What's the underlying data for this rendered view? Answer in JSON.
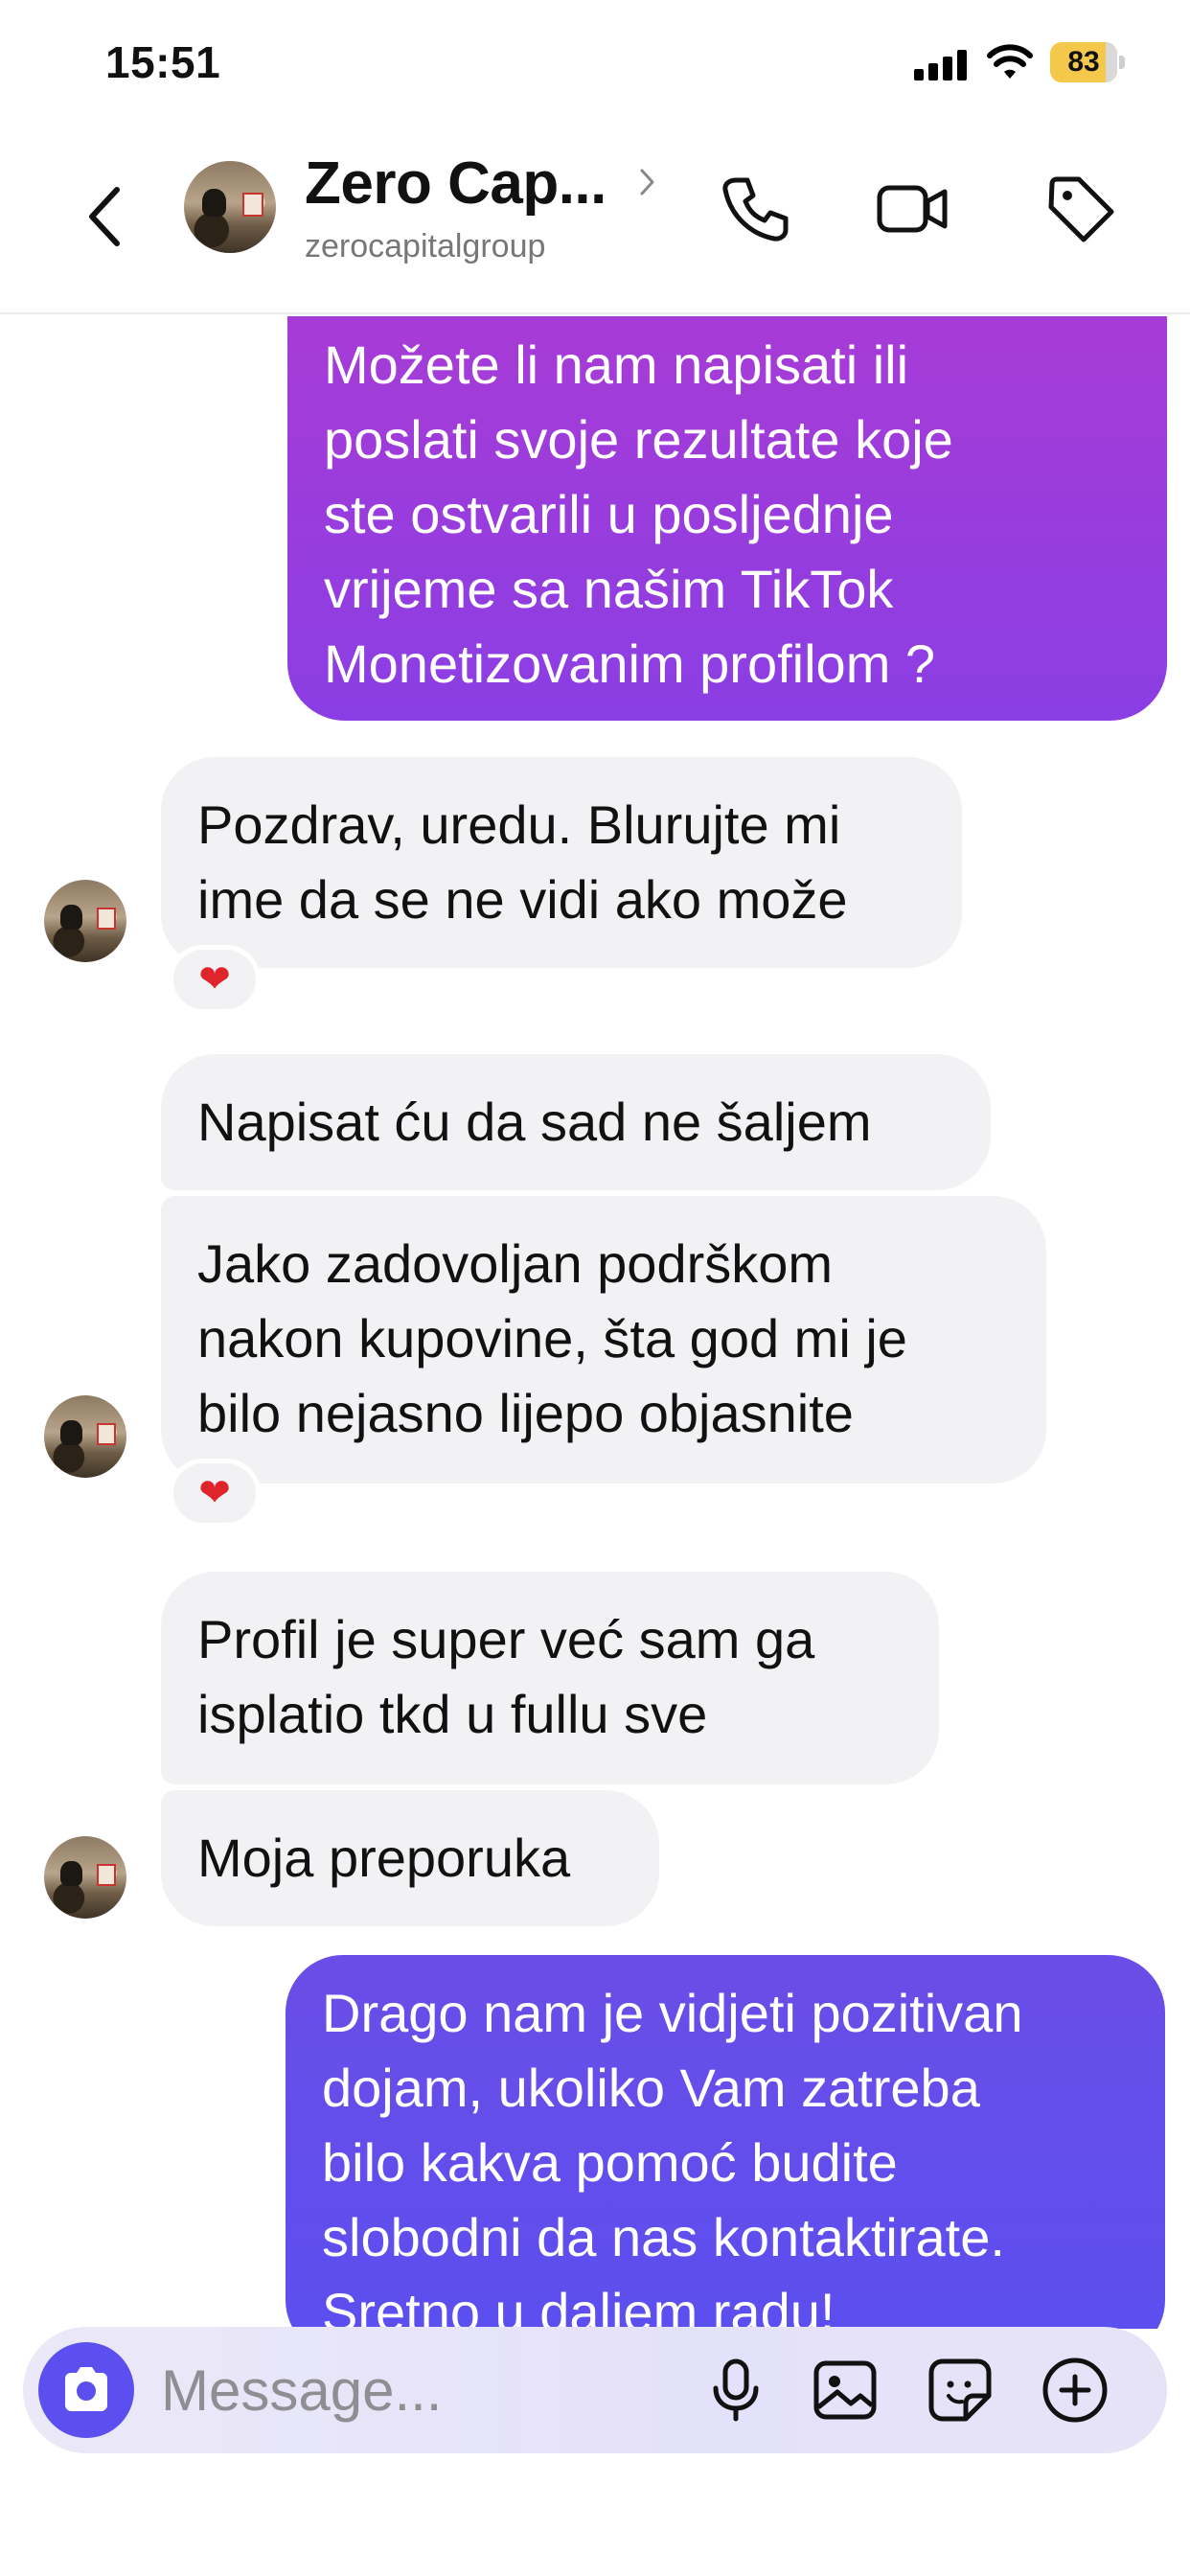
{
  "status_bar": {
    "time": "15:51",
    "battery": "83"
  },
  "header": {
    "contact_name": "Zero Cap...",
    "contact_handle": "zerocapitalgroup"
  },
  "messages": [
    {
      "direction": "out",
      "text": "Možete li nam napisati ili\nposlati svoje rezultate koje\nste ostvarili u posljednje\nvrijeme sa našim TikTok\nMonetizovanim profilom ?"
    },
    {
      "direction": "in",
      "text": "Pozdrav, uredu. Blurujte mi\nime da se ne vidi ako može",
      "reaction": "heart"
    },
    {
      "direction": "in",
      "text": "Napisat ću da sad ne šaljem"
    },
    {
      "direction": "in",
      "text": "Jako zadovoljan podrškom\nnakon kupovine, šta god mi je\nbilo nejasno lijepo objasnite",
      "reaction": "heart"
    },
    {
      "direction": "in",
      "text": "Profil je super već sam ga\nisplatio tkd u fullu sve"
    },
    {
      "direction": "in",
      "text": "Moja preporuka"
    },
    {
      "direction": "out",
      "text": "Drago nam je vidjeti pozitivan\ndojam, ukoliko Vam zatreba\nbilo kakva pomoć budite\nslobodni da nas kontaktirate.\nSretno u daljem radu!"
    }
  ],
  "reactions": {
    "heart": "❤"
  },
  "composer": {
    "placeholder": "Message..."
  },
  "colors": {
    "accent": "#5b4ff0",
    "outgoing_top": "#a83bd6",
    "incoming_bg": "#f2f2f4"
  },
  "icons": [
    "back-arrow-icon",
    "chevron-right-icon",
    "phone-icon",
    "video-camera-icon",
    "tag-icon",
    "camera-icon",
    "microphone-icon",
    "gallery-icon",
    "sticker-icon",
    "plus-circle-icon"
  ]
}
